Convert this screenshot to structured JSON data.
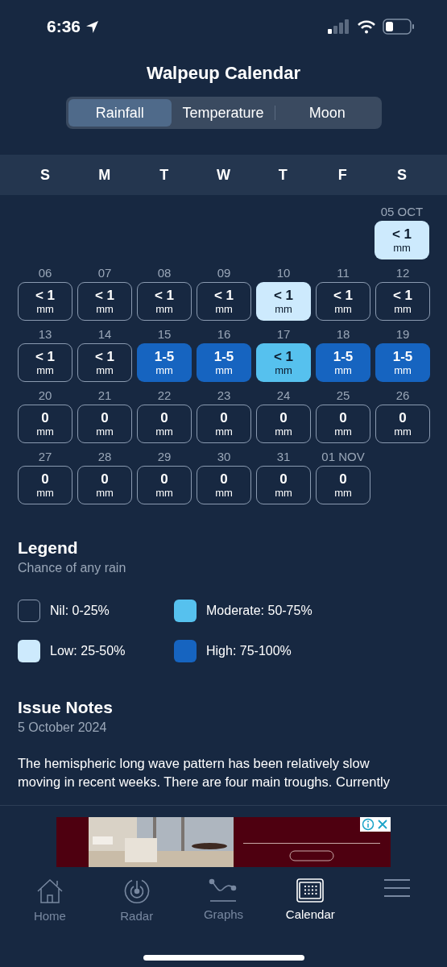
{
  "status_bar": {
    "time": "6:36"
  },
  "title": "Walpeup Calendar",
  "tabs": [
    {
      "label": "Rainfall",
      "selected": true
    },
    {
      "label": "Temperature",
      "selected": false
    },
    {
      "label": "Moon",
      "selected": false
    }
  ],
  "weekdays": [
    "S",
    "M",
    "T",
    "W",
    "T",
    "F",
    "S"
  ],
  "weeks": [
    {
      "kind": "month-start",
      "days": [
        {
          "date": "05 OCT",
          "amount": "< 1",
          "unit": "mm",
          "kind": "low"
        }
      ]
    },
    {
      "kind": "regular",
      "days": [
        {
          "date": "06",
          "amount": "< 1",
          "unit": "mm",
          "kind": "nil"
        },
        {
          "date": "07",
          "amount": "< 1",
          "unit": "mm",
          "kind": "nil"
        },
        {
          "date": "08",
          "amount": "< 1",
          "unit": "mm",
          "kind": "nil"
        },
        {
          "date": "09",
          "amount": "< 1",
          "unit": "mm",
          "kind": "nil"
        },
        {
          "date": "10",
          "amount": "< 1",
          "unit": "mm",
          "kind": "low"
        },
        {
          "date": "11",
          "amount": "< 1",
          "unit": "mm",
          "kind": "nil"
        },
        {
          "date": "12",
          "amount": "< 1",
          "unit": "mm",
          "kind": "nil"
        }
      ]
    },
    {
      "kind": "regular",
      "days": [
        {
          "date": "13",
          "amount": "< 1",
          "unit": "mm",
          "kind": "nil"
        },
        {
          "date": "14",
          "amount": "< 1",
          "unit": "mm",
          "kind": "nil"
        },
        {
          "date": "15",
          "amount": "1-5",
          "unit": "mm",
          "kind": "high"
        },
        {
          "date": "16",
          "amount": "1-5",
          "unit": "mm",
          "kind": "high"
        },
        {
          "date": "17",
          "amount": "< 1",
          "unit": "mm",
          "kind": "moderate"
        },
        {
          "date": "18",
          "amount": "1-5",
          "unit": "mm",
          "kind": "high"
        },
        {
          "date": "19",
          "amount": "1-5",
          "unit": "mm",
          "kind": "high"
        }
      ]
    },
    {
      "kind": "regular",
      "days": [
        {
          "date": "20",
          "amount": "0",
          "unit": "mm",
          "kind": "nil"
        },
        {
          "date": "21",
          "amount": "0",
          "unit": "mm",
          "kind": "nil"
        },
        {
          "date": "22",
          "amount": "0",
          "unit": "mm",
          "kind": "nil"
        },
        {
          "date": "23",
          "amount": "0",
          "unit": "mm",
          "kind": "nil"
        },
        {
          "date": "24",
          "amount": "0",
          "unit": "mm",
          "kind": "nil"
        },
        {
          "date": "25",
          "amount": "0",
          "unit": "mm",
          "kind": "nil"
        },
        {
          "date": "26",
          "amount": "0",
          "unit": "mm",
          "kind": "nil"
        }
      ]
    },
    {
      "kind": "regular",
      "days": [
        {
          "date": "27",
          "amount": "0",
          "unit": "mm",
          "kind": "nil"
        },
        {
          "date": "28",
          "amount": "0",
          "unit": "mm",
          "kind": "nil"
        },
        {
          "date": "29",
          "amount": "0",
          "unit": "mm",
          "kind": "nil"
        },
        {
          "date": "30",
          "amount": "0",
          "unit": "mm",
          "kind": "nil"
        },
        {
          "date": "31",
          "amount": "0",
          "unit": "mm",
          "kind": "nil"
        },
        {
          "date": "01 NOV",
          "amount": "0",
          "unit": "mm",
          "kind": "nil"
        }
      ]
    }
  ],
  "legend": {
    "title": "Legend",
    "subtitle": "Chance of any rain",
    "items": [
      {
        "label": "Nil: 0-25%",
        "kind": "nil"
      },
      {
        "label": "Moderate: 50-75%",
        "kind": "moderate"
      },
      {
        "label": "Low: 25-50%",
        "kind": "low"
      },
      {
        "label": "High: 75-100%",
        "kind": "high"
      }
    ]
  },
  "notes": {
    "title": "Issue Notes",
    "date": "5 October 2024",
    "text": "The hemispheric long wave pattern has been relatively slow moving in recent weeks. There are four main troughs. Currently"
  },
  "nav": [
    {
      "kind": "home",
      "label": "Home",
      "selected": false
    },
    {
      "kind": "radar",
      "label": "Radar",
      "selected": false
    },
    {
      "kind": "graphs",
      "label": "Graphs",
      "selected": false
    },
    {
      "kind": "calendar",
      "label": "Calendar",
      "selected": true
    },
    {
      "kind": "menu",
      "selected": false
    }
  ]
}
